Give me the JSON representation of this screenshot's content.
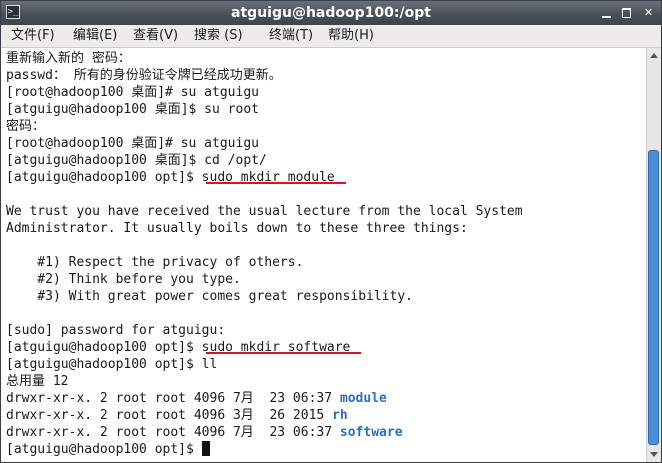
{
  "window": {
    "title": "atguigu@hadoop100:/opt",
    "icon": "terminal-icon",
    "controls": [
      "minimize-icon",
      "maximize-icon",
      "close-icon"
    ],
    "close_glyph": "✕"
  },
  "menu": {
    "items": [
      "文件(F)",
      "编辑(E)",
      "查看(V)",
      "搜索 (S)",
      "终端(T)",
      "帮助(H)"
    ]
  },
  "terminal": {
    "lines": [
      "重新输入新的 密码：",
      "passwd： 所有的身份验证令牌已经成功更新。",
      "[root@hadoop100 桌面]# su atguigu",
      "[atguigu@hadoop100 桌面]$ su root",
      "密码：",
      "[root@hadoop100 桌面]# su atguigu",
      "[atguigu@hadoop100 桌面]$ cd /opt/",
      "[atguigu@hadoop100 opt]$ ",
      "sudo mkdir module",
      "",
      "We trust you have received the usual lecture from the local System",
      "Administrator. It usually boils down to these three things:",
      "",
      "    #1) Respect the privacy of others.",
      "    #2) Think before you type.",
      "    #3) With great power comes great responsibility.",
      "",
      "[sudo] password for atguigu:",
      "[atguigu@hadoop100 opt]$ ",
      "sudo mkdir software",
      "[atguigu@hadoop100 opt]$ ll",
      "总用量 12",
      "drwxr-xr-x. 2 root root 4096 7月  23 06:37 ",
      "module",
      "drwxr-xr-x. 2 root root 4096 3月  26 2015 ",
      "rh",
      "drwxr-xr-x. 2 root root 4096 7月  23 06:37 ",
      "software",
      "[atguigu@hadoop100 opt]$ "
    ]
  },
  "annotation_color": "#d8141f",
  "directory_color": "#2e6fbe"
}
